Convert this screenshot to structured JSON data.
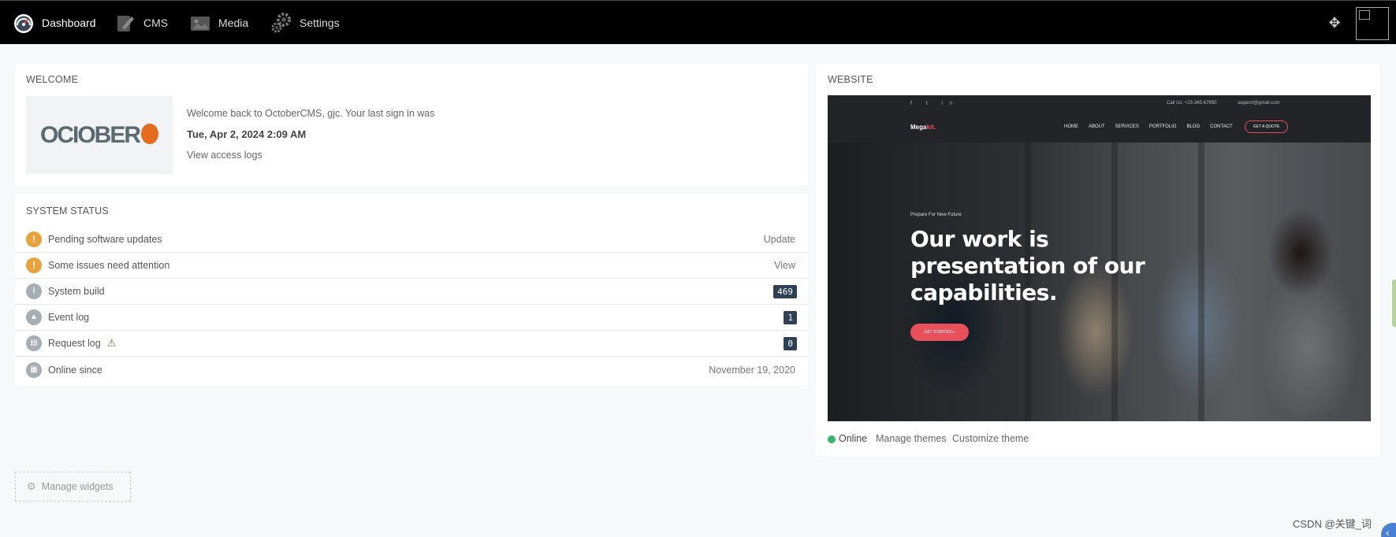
{
  "nav": {
    "items": [
      {
        "label": "Dashboard",
        "icon": "speedometer-icon"
      },
      {
        "label": "CMS",
        "icon": "cms-icon"
      },
      {
        "label": "Media",
        "icon": "media-icon"
      },
      {
        "label": "Settings",
        "icon": "settings-gears-icon"
      }
    ],
    "active": "Dashboard",
    "right_icon": "move-arrows-icon"
  },
  "welcome": {
    "title": "WELCOME",
    "logo_text": "OCIOBER",
    "message": "Welcome back to OctoberCMS, gjc. Your last sign in was",
    "last_signin": "Tue, Apr 2, 2024 2:09 AM",
    "access_logs_link": "View access logs"
  },
  "status": {
    "title": "SYSTEM STATUS",
    "rows": [
      {
        "label": "Pending software updates",
        "action": "Update",
        "icon": "warning-icon"
      },
      {
        "label": "Some issues need attention",
        "action": "View",
        "icon": "warning-icon"
      },
      {
        "label": "System build",
        "badge": "469",
        "icon": "info-icon"
      },
      {
        "label": "Event log",
        "badge": "1",
        "icon": "event-log-icon"
      },
      {
        "label": "Request log",
        "badge": "0",
        "icon": "request-log-icon"
      },
      {
        "label": "Online since",
        "value": "November 19, 2020",
        "icon": "calendar-icon"
      }
    ]
  },
  "website": {
    "title": "WEBSITE",
    "preview": {
      "contact": "Call Us: +23-345-67890",
      "email": "support@gmail.com",
      "brand": "Mega",
      "brand_accent": "kit.",
      "menu": [
        "HOME",
        "ABOUT",
        "SERVICES",
        "PORTFOLIO",
        "BLOG",
        "CONTACT"
      ],
      "quote_button": "GET A QUOTE",
      "subtitle": "Prepare For New Future",
      "headline": "Our work is presentation of our capabilities.",
      "cta": "GET STARTED ▸"
    },
    "status": "Online",
    "manage_themes": "Manage themes",
    "customize_theme": "Customize theme"
  },
  "manage_widgets": "Manage widgets",
  "watermark": "CSDN @关键_词",
  "colors": {
    "accent_warning": "#e9a23b",
    "online": "#3cb371",
    "badge": "#2f3f54",
    "brand_red": "#e8505b"
  }
}
